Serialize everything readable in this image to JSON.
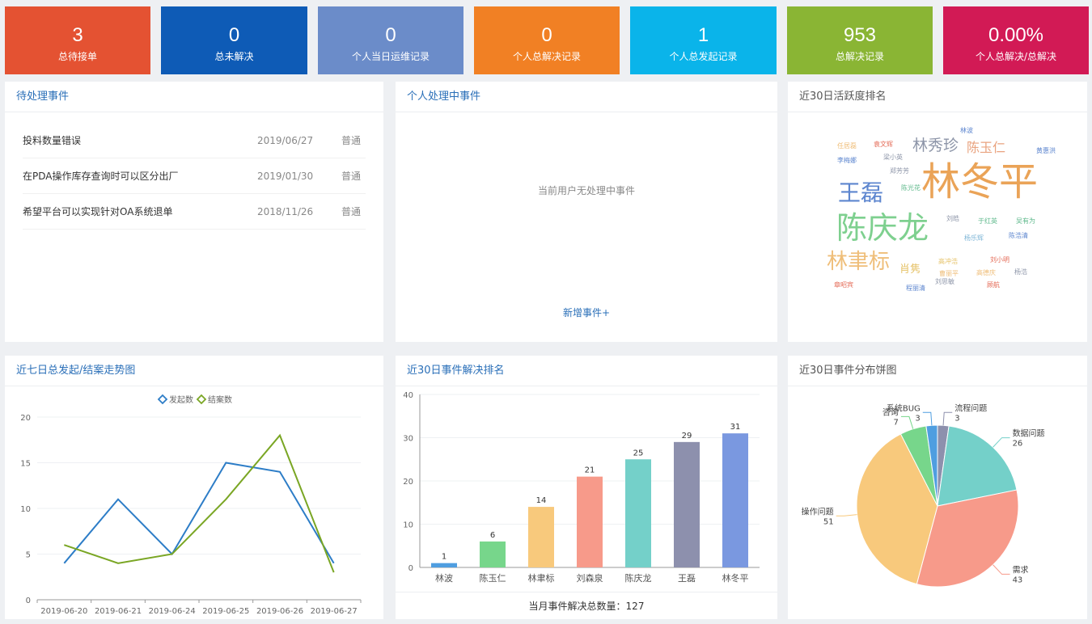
{
  "stats": [
    {
      "value": "3",
      "label": "总待接单",
      "color": "#e45232"
    },
    {
      "value": "0",
      "label": "总未解决",
      "color": "#0e5bb6"
    },
    {
      "value": "0",
      "label": "个人当日运维记录",
      "color": "#6b8cc9"
    },
    {
      "value": "0",
      "label": "个人总解决记录",
      "color": "#f18024"
    },
    {
      "value": "1",
      "label": "个人总发起记录",
      "color": "#0ab4ea"
    },
    {
      "value": "953",
      "label": "总解决记录",
      "color": "#8ab534"
    },
    {
      "value": "0.00%",
      "label": "个人总解决/总解决",
      "color": "#d21a55"
    }
  ],
  "pending": {
    "title": "待处理事件",
    "items": [
      {
        "title": "投料数量错误",
        "date": "2019/06/27",
        "priority": "普通"
      },
      {
        "title": "在PDA操作库存查询时可以区分出厂",
        "date": "2019/01/30",
        "priority": "普通"
      },
      {
        "title": "希望平台可以实现针对OA系统退单",
        "date": "2018/11/26",
        "priority": "普通"
      }
    ]
  },
  "personal": {
    "title": "个人处理中事件",
    "empty_text": "当前用户无处理中事件",
    "add_label": "新增事件+"
  },
  "activity": {
    "title": "近30日活跃度排名",
    "words": [
      {
        "text": "林冬平",
        "color": "#eaa357"
      },
      {
        "text": "陈庆龙",
        "color": "#7ed08f"
      },
      {
        "text": "王磊",
        "color": "#5d86cf"
      },
      {
        "text": "林聿标",
        "color": "#efbe79"
      },
      {
        "text": "林秀珍",
        "color": "#8d95a8"
      },
      {
        "text": "陈玉仁",
        "color": "#e9a37f"
      },
      {
        "text": "肖隽",
        "color": "#e6c36a"
      },
      {
        "text": "任居磊",
        "color": "#efbe79"
      },
      {
        "text": "袁文辉",
        "color": "#e46a56"
      },
      {
        "text": "梁小英",
        "color": "#8d95a8"
      },
      {
        "text": "李梅娜",
        "color": "#5d86cf"
      },
      {
        "text": "郑芳芳",
        "color": "#8d95a8"
      },
      {
        "text": "陈光花",
        "color": "#5fb98c"
      },
      {
        "text": "林波",
        "color": "#5d86cf"
      },
      {
        "text": "黄惠洪",
        "color": "#5d86cf"
      },
      {
        "text": "刘皓",
        "color": "#8d95a8"
      },
      {
        "text": "于红英",
        "color": "#5fb98c"
      },
      {
        "text": "吴有为",
        "color": "#5fb98c"
      },
      {
        "text": "杨乐辉",
        "color": "#7cb4d6"
      },
      {
        "text": "陈浩清",
        "color": "#5d86cf"
      },
      {
        "text": "高冲浩",
        "color": "#e6c36a"
      },
      {
        "text": "刘小明",
        "color": "#e46a56"
      },
      {
        "text": "曹丽平",
        "color": "#efbe79"
      },
      {
        "text": "高德庆",
        "color": "#efbe79"
      },
      {
        "text": "杨浩",
        "color": "#8d95a8"
      },
      {
        "text": "刘思敏",
        "color": "#8d95a8"
      },
      {
        "text": "章昭宾",
        "color": "#e46a56"
      },
      {
        "text": "程丽清",
        "color": "#5d86cf"
      },
      {
        "text": "顾航",
        "color": "#e46a56"
      }
    ]
  },
  "trend": {
    "title": "近七日总发起/结案走势图",
    "chart_data": {
      "type": "line",
      "categories": [
        "2019-06-20",
        "2019-06-21",
        "2019-06-24",
        "2019-06-25",
        "2019-06-26",
        "2019-06-27"
      ],
      "x": [
        0,
        0.5,
        1,
        1.5,
        2,
        2.5,
        3,
        3.5,
        4,
        4.5,
        5,
        5.5
      ],
      "series": [
        {
          "name": "发起数",
          "color": "#2d7dc7",
          "values": [
            null,
            4,
            null,
            11,
            null,
            5,
            null,
            15,
            null,
            14,
            null,
            4
          ]
        },
        {
          "name": "结案数",
          "color": "#7aa624",
          "values": [
            null,
            6,
            null,
            4,
            null,
            5,
            null,
            11,
            null,
            18,
            null,
            3
          ]
        }
      ],
      "ylim": [
        0,
        20
      ],
      "yticks": [
        0,
        5,
        10,
        15,
        20
      ],
      "legend": "top-center",
      "grid": true
    }
  },
  "ranking": {
    "title": "近30日事件解决排名",
    "footer_label": "当月事件解决总数量：",
    "footer_value": "127",
    "chart_data": {
      "type": "bar",
      "categories": [
        "林波",
        "陈玉仁",
        "林聿标",
        "刘森泉",
        "陈庆龙",
        "王磊",
        "林冬平"
      ],
      "values": [
        1,
        6,
        14,
        21,
        25,
        29,
        31
      ],
      "colors": [
        "#4f9ee0",
        "#77d68b",
        "#f8c97c",
        "#f79a8a",
        "#74d0c9",
        "#8d90ad",
        "#7a98e0"
      ],
      "ylim": [
        0,
        40
      ],
      "yticks": [
        0,
        10,
        20,
        30,
        40
      ],
      "grid": true
    }
  },
  "pie": {
    "title": "近30日事件分布饼图",
    "chart_data": {
      "type": "pie",
      "slices": [
        {
          "label": "流程问题",
          "value": 3,
          "color": "#8d90ad"
        },
        {
          "label": "数据问题",
          "value": 26,
          "color": "#74d0c9"
        },
        {
          "label": "需求",
          "value": 43,
          "color": "#f79a8a"
        },
        {
          "label": "操作问题",
          "value": 51,
          "color": "#f8c97c"
        },
        {
          "label": "咨询",
          "value": 7,
          "color": "#77d68b"
        },
        {
          "label": "系统BUG",
          "value": 3,
          "color": "#4f9ee0"
        }
      ]
    }
  }
}
